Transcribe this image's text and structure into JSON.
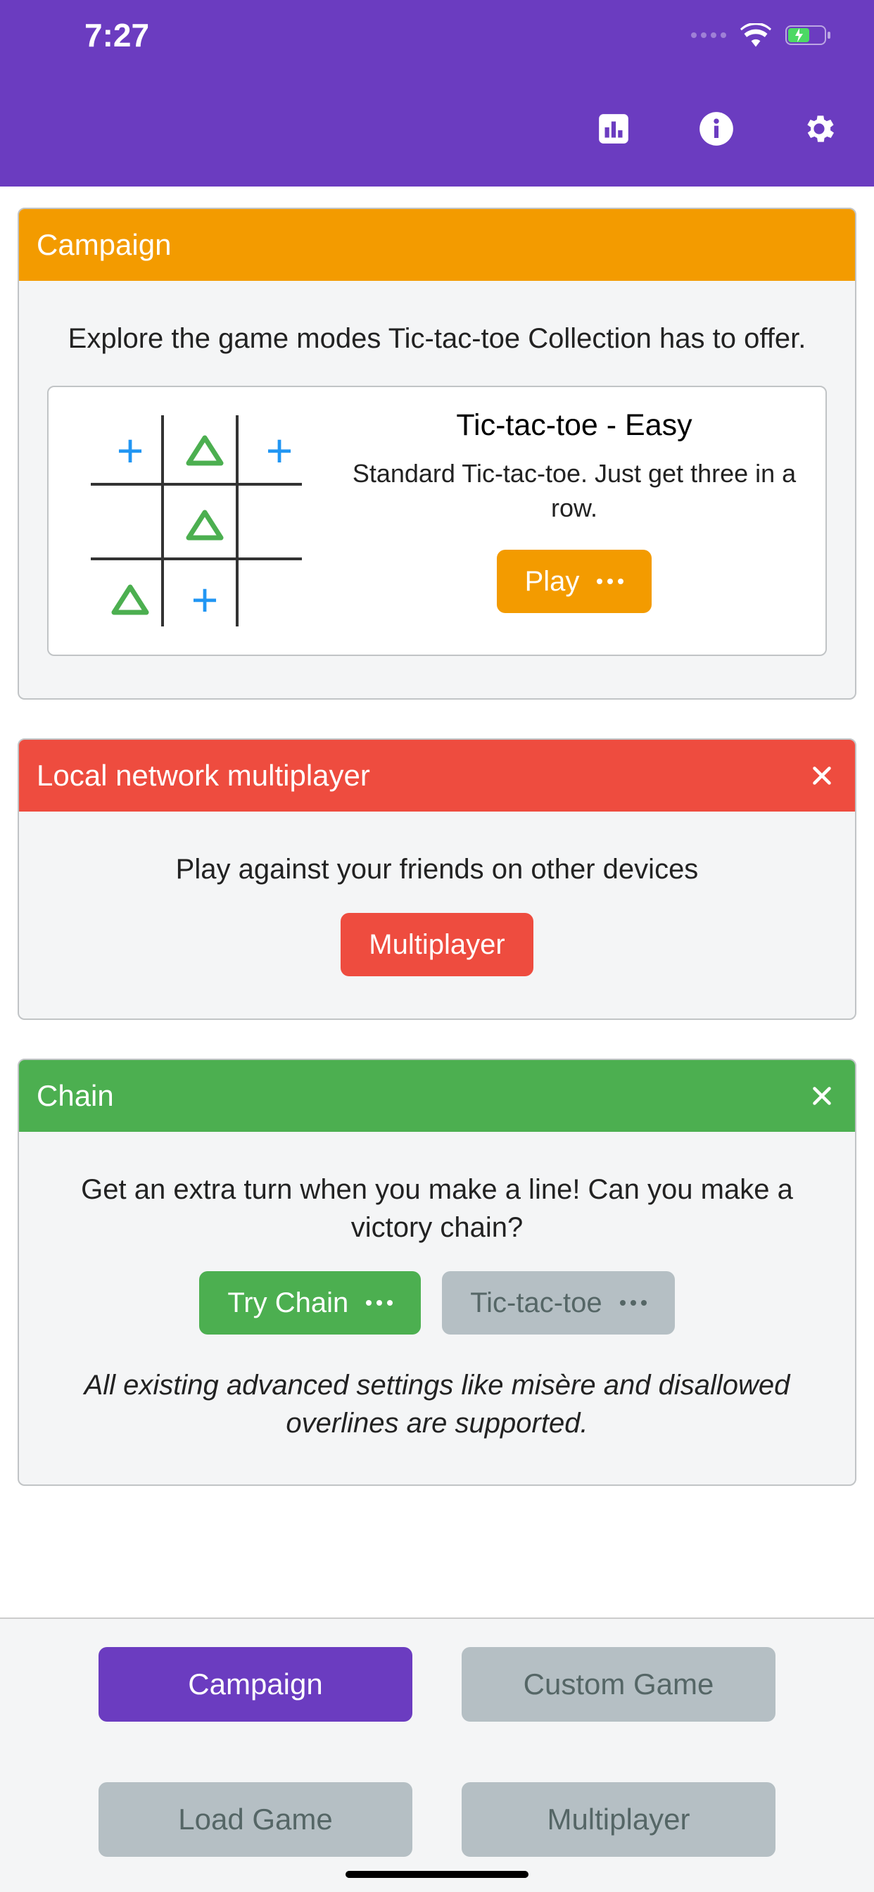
{
  "status": {
    "time": "7:27"
  },
  "colors": {
    "purple": "#6b3cc0",
    "orange": "#f39b00",
    "red": "#ee4c3f",
    "green": "#4CAF50",
    "grey": "#b5bfc4"
  },
  "campaign": {
    "title": "Campaign",
    "intro": "Explore the game modes Tic-tac-toe Collection has to offer.",
    "tile": {
      "name": "Tic-tac-toe - Easy",
      "desc": "Standard Tic-tac-toe. Just get three in a row.",
      "play": "Play"
    }
  },
  "lan": {
    "title": "Local network multiplayer",
    "desc": "Play against your friends on other devices",
    "btn": "Multiplayer"
  },
  "chain": {
    "title": "Chain",
    "desc": "Get an extra turn when you make a line! Can you make a victory chain?",
    "try": "Try Chain",
    "ttt": "Tic-tac-toe",
    "note": "All existing advanced settings like misère and disallowed overlines are supported."
  },
  "tabs": {
    "campaign": "Campaign",
    "custom": "Custom Game",
    "load": "Load Game",
    "multi": "Multiplayer"
  }
}
